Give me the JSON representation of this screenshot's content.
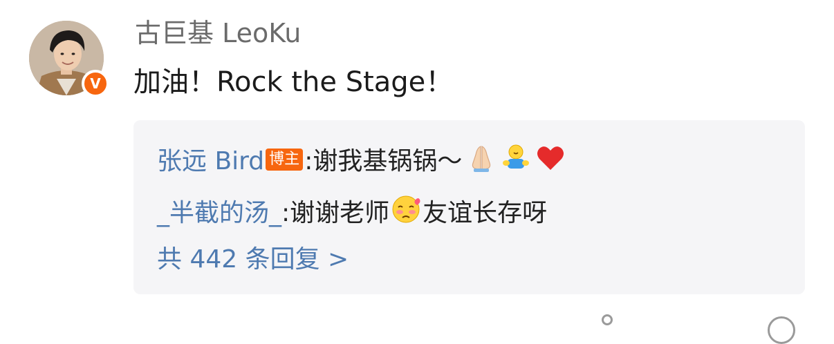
{
  "comment": {
    "author": "古巨基 LeoKu",
    "verified_badge": "V",
    "text": "加油！Rock the Stage！"
  },
  "replies": [
    {
      "author": "张远 Bird",
      "badge": "博主",
      "colon": ":",
      "text": " 谢我基锅锅～",
      "emojis": [
        "folded-hands-icon",
        "hug-icon",
        "red-heart-icon"
      ]
    },
    {
      "author": "_半截的汤_",
      "colon": ":",
      "text_before": " 谢谢老师",
      "emoji": "shy-face-icon",
      "text_after": "友谊长存呀"
    }
  ],
  "reply_count_link": "共 442 条回复 >",
  "colors": {
    "link_blue": "#4e7ab0",
    "badge_orange": "#f7660f",
    "reply_bg": "#f5f5f7"
  }
}
